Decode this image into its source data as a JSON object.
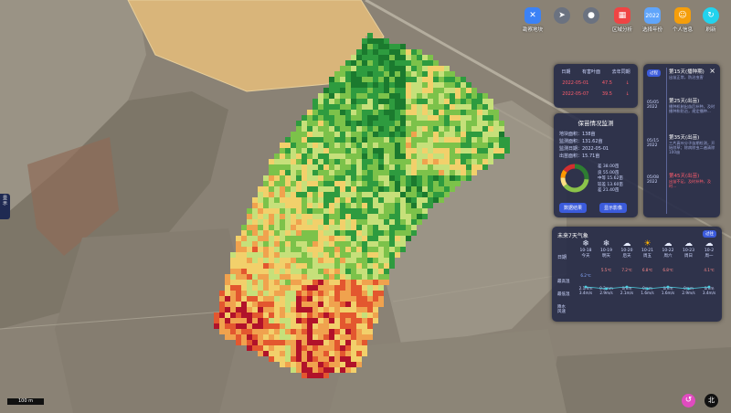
{
  "toolbar": [
    {
      "label": "勘察地块",
      "icon": "tools-icon",
      "color": "#3b82f6"
    },
    {
      "label": "",
      "icon": "locate-icon",
      "color": "#6b7280"
    },
    {
      "label": "",
      "icon": "pin-icon",
      "color": "#6b7280"
    },
    {
      "label": "区域分析",
      "icon": "grid-icon",
      "color": "#ef4444"
    },
    {
      "label": "选择年份",
      "icon": "year-icon",
      "color": "#60a5fa",
      "badge": "2022"
    },
    {
      "label": "个人信息",
      "icon": "user-icon",
      "color": "#f59e0b"
    },
    {
      "label": "刷新",
      "icon": "refresh-icon",
      "color": "#22d3ee"
    }
  ],
  "table": {
    "headers": [
      "日期",
      "有害叶面",
      "去年同期"
    ],
    "rows": [
      [
        "2022-05-01",
        "47.5",
        "↓"
      ],
      [
        "2022-05-07",
        "39.5",
        "↓"
      ]
    ]
  },
  "monitor": {
    "title": "保苗情况监测",
    "info": [
      "地块面积：138亩",
      "监测面积：131.62亩",
      "监测日期：2022-05-01",
      "出苗面积：15.71亩"
    ],
    "legend": [
      "差  38.00亩",
      "良  55.00亩",
      "中等 15.62亩",
      "较差 13.60亩",
      "差  21.40亩"
    ],
    "donut": [
      38,
      55,
      15.62,
      13.6,
      21.4
    ],
    "donut_colors": [
      "#2e7d32",
      "#8bc34a",
      "#ffe082",
      "#ff9800",
      "#d32f2f"
    ],
    "btn_detail": "数据结果",
    "btn_image": "显示影像"
  },
  "timeline": {
    "tag": "过程",
    "items": [
      {
        "date": "",
        "title": "第15天(播种期)",
        "desc": "出苗正常，防治虫害",
        "hl": false
      },
      {
        "date": "05/05\n2022",
        "title": "第25天(出苗)",
        "desc": "播种机制出苗后补种，及时播种和防治，规定播种...",
        "hl": false
      },
      {
        "date": "05/15\n2022",
        "title": "第35天(出苗)",
        "desc": "三片真叶分子苗期检测，开始除草；除病除虫二遍清除100亩",
        "hl": false
      },
      {
        "date": "05/08\n2022",
        "title": "第45天(出苗)",
        "desc": "出苗不足，及时补种，及时...",
        "hl": true
      }
    ]
  },
  "weather": {
    "title": "未来7天气象",
    "badge": "过往",
    "row_label_date": "日期",
    "row_label_max": "最高温",
    "row_label_min": "最低温",
    "row_label_wind": "降水\n风速",
    "days": [
      {
        "date": "10-18",
        "name": "今天",
        "icon": "snow-icon",
        "hi": "",
        "lo": "6.2℃",
        "rain": "2.1mm",
        "wind": "3.4m/s"
      },
      {
        "date": "10-19",
        "name": "明天",
        "icon": "snow-icon",
        "hi": "5.5℃",
        "lo": "",
        "rain": "0.2mm",
        "wind": "2.9m/s"
      },
      {
        "date": "10-20",
        "name": "后天",
        "icon": "cloud-icon",
        "hi": "7.2℃",
        "lo": "",
        "rain": "0mm",
        "wind": "2.1m/s"
      },
      {
        "date": "10-21",
        "name": "周五",
        "icon": "sun-icon",
        "hi": "6.8℃",
        "lo": "",
        "rain": "0mm",
        "wind": "1.6m/s"
      },
      {
        "date": "10-22",
        "name": "周六",
        "icon": "cloud-icon",
        "hi": "6.8℃",
        "lo": "",
        "rain": "0mm",
        "wind": "1.6m/s"
      },
      {
        "date": "10-23",
        "name": "周日",
        "icon": "cloud-icon",
        "hi": "",
        "lo": "",
        "rain": "0mm",
        "wind": "2.9m/s"
      },
      {
        "date": "10-2",
        "name": "周一",
        "icon": "cloud-icon",
        "hi": "4.1℃",
        "lo": "",
        "rain": "0mm",
        "wind": "3.4m/s"
      }
    ]
  },
  "left_tab": "显\n示",
  "scale": "100 m",
  "compass": "北",
  "back_icon": "back-icon",
  "close": "×"
}
